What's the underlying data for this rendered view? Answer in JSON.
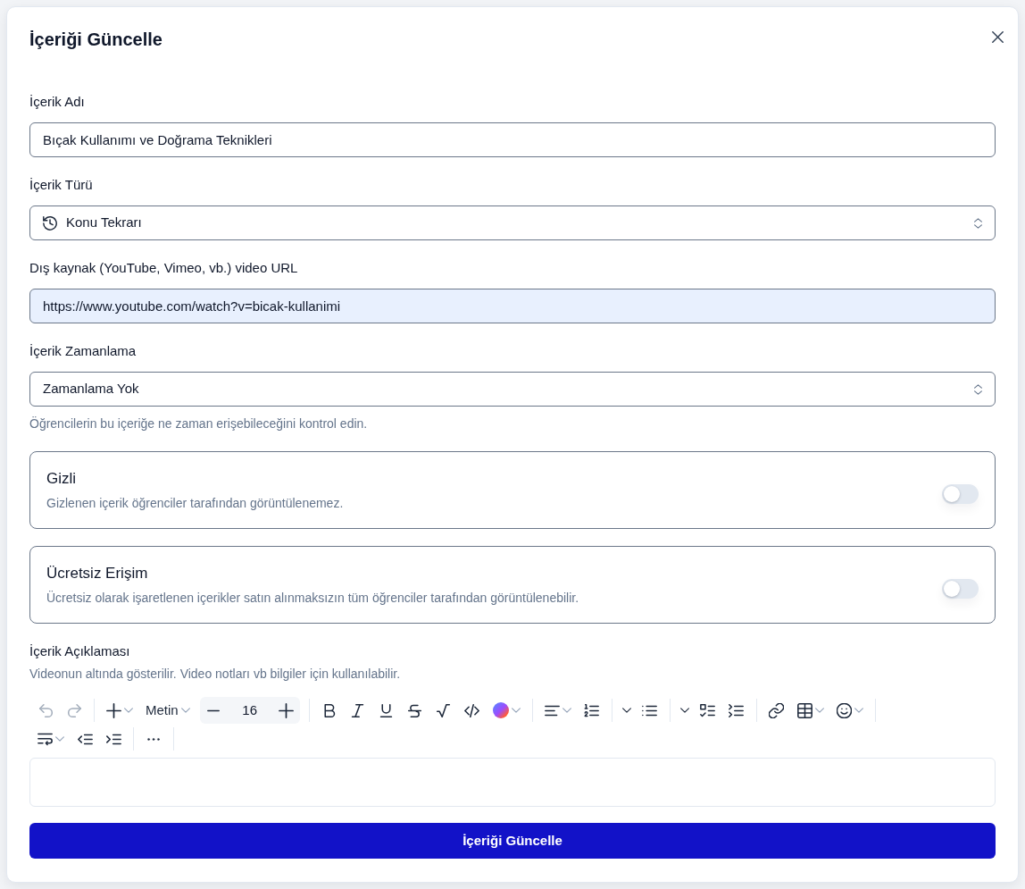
{
  "dialog": {
    "title": "İçeriği Güncelle"
  },
  "fields": [
    {
      "kind": "input",
      "label": "İçerik Adı",
      "value": "Bıçak Kullanımı ve Doğrama Teknikleri",
      "autofilled": false
    },
    {
      "kind": "select",
      "label": "İçerik Türü",
      "value": "Konu Tekrarı",
      "icon": true
    },
    {
      "kind": "input",
      "label": "Dış kaynak (YouTube, Vimeo, vb.) video URL",
      "value": "https://www.youtube.com/watch?v=bicak-kullanimi",
      "autofilled": true
    },
    {
      "kind": "select",
      "label": "İçerik Zamanlama",
      "value": "Zamanlama Yok",
      "icon": false,
      "hint": "Öğrencilerin bu içeriğe ne zaman erişebileceğini kontrol edin."
    }
  ],
  "toggles": [
    {
      "title": "Gizli",
      "description": "Gizlenen içerik öğrenciler tarafından görüntülenemez.",
      "on": false
    },
    {
      "title": "Ücretsiz Erişim",
      "description": "Ücretsiz olarak işaretlenen içerikler satın alınmaksızın tüm öğrenciler tarafından görüntülenebilir.",
      "on": false
    }
  ],
  "description_editor": {
    "label": "İçerik Açıklaması",
    "hint": "Videonun altında gösterilir. Video notları vb bilgiler için kullanılabilir.",
    "toolbar": {
      "undo_disabled": true,
      "redo_disabled": true,
      "block_type": "Metin",
      "font_size": "16"
    }
  },
  "submit": {
    "label": "İçeriği Güncelle"
  }
}
